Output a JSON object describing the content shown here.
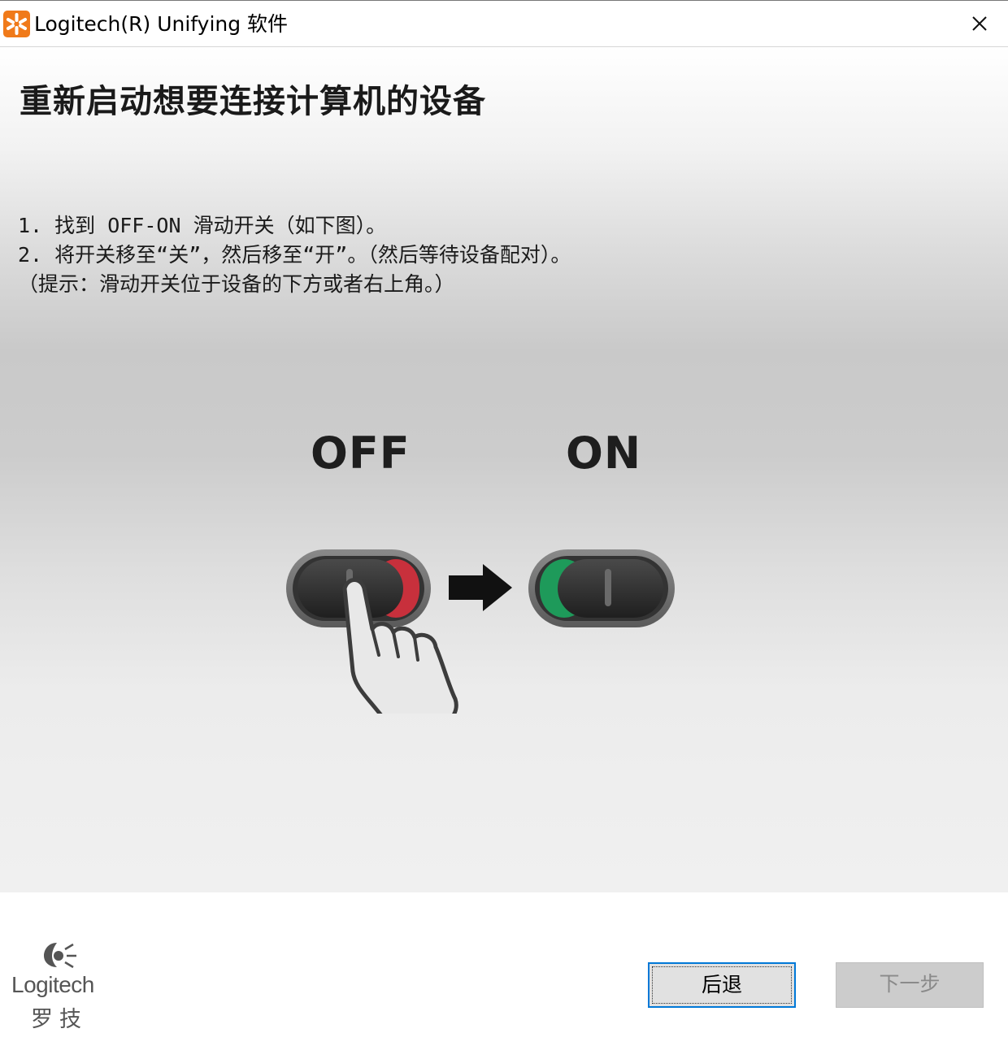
{
  "window": {
    "title": "Logitech(R) Unifying 软件",
    "icon": "logitech-unifying-icon",
    "close_icon": "close-icon"
  },
  "main": {
    "heading": "重新启动想要连接计算机的设备",
    "instructions": [
      "1. 找到 OFF-ON 滑动开关（如下图）。",
      "2. 将开关移至“关”，然后移至“开”。（然后等待设备配对）。",
      "（提示：滑动开关位于设备的下方或者右上角。）"
    ],
    "illustration": {
      "off_label": "OFF",
      "on_label": "ON",
      "off_color": "#c8303c",
      "on_color": "#1e9a5a"
    }
  },
  "footer": {
    "logo_text": "Logitech",
    "logo_cn": "罗技",
    "back_label": "后退",
    "next_label": "下一步"
  },
  "colors": {
    "accent": "#0078d7",
    "app_icon": "#f07a1a"
  }
}
